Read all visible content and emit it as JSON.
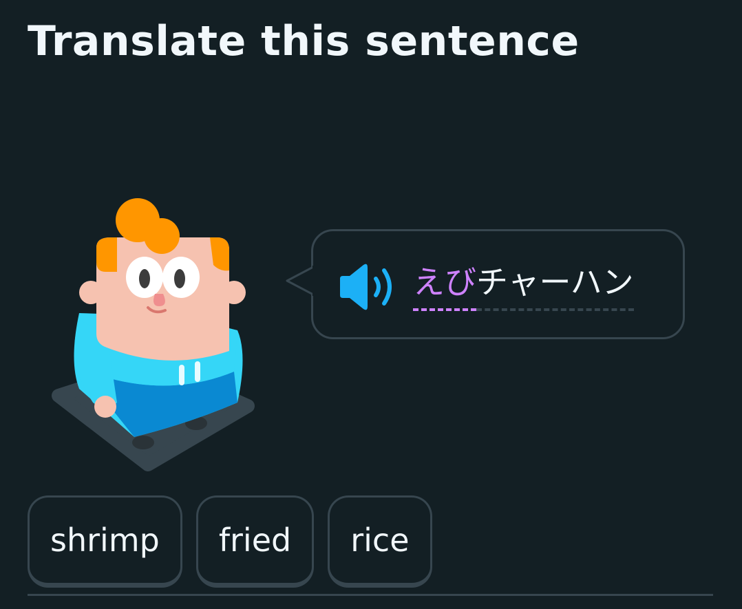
{
  "header": {
    "title": "Translate this sentence"
  },
  "prompt": {
    "character": "mascot-character",
    "speaker_icon": "speaker-icon",
    "tokens": [
      {
        "text": "えび",
        "highlight": true
      },
      {
        "text": "チャーハン",
        "highlight": false
      }
    ]
  },
  "word_bank": {
    "words": [
      "shrimp",
      "fried",
      "rice"
    ]
  },
  "colors": {
    "background": "#131f24",
    "border": "#37464f",
    "highlight": "#ce82ff",
    "speaker": "#1cb0f6",
    "text": "#f1f7fb"
  }
}
